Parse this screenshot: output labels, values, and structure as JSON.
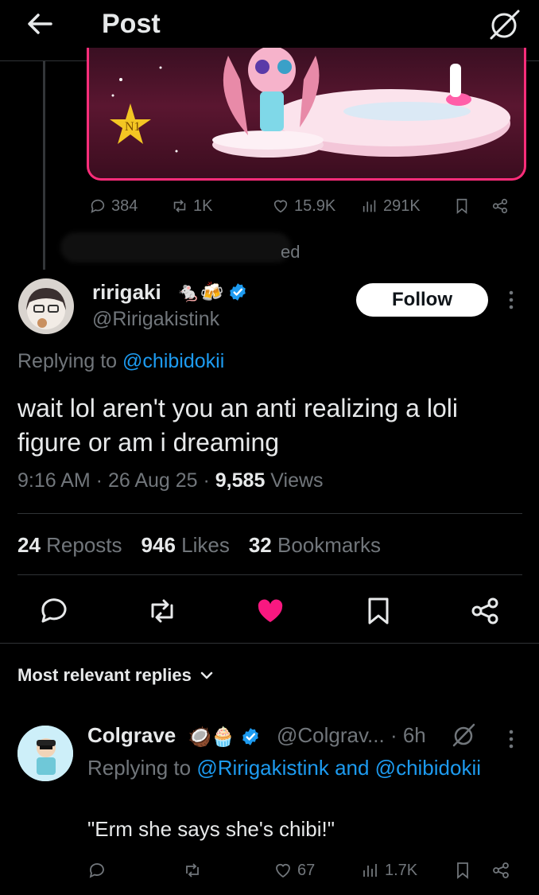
{
  "header": {
    "title": "Post"
  },
  "parent_post": {
    "stats": {
      "replies": "384",
      "reposts": "1K",
      "likes": "15.9K",
      "views": "291K"
    },
    "redacted_suffix": "ed"
  },
  "main_post": {
    "display_name": "ririgaki",
    "badges": "🐁🍻",
    "handle": "@Ririgakistink",
    "follow_label": "Follow",
    "replying_prefix": "Replying to ",
    "replying_to": "@chibidokii",
    "text": "wait lol aren't you an anti realizing a loli figure or am i dreaming",
    "time": "9:16 AM · 26 Aug 25 · ",
    "views_count": "9,585",
    "views_label": " Views",
    "reposts_count": "24",
    "reposts_label": " Reposts",
    "likes_count": "946",
    "likes_label": " Likes",
    "bookmarks_count": "32",
    "bookmarks_label": " Bookmarks",
    "colors": {
      "like": "#f91880",
      "verified": "#1d9bf0",
      "link": "#1d9bf0"
    }
  },
  "replies_sort": {
    "label": "Most relevant replies"
  },
  "reply": {
    "display_name": "Colgrave",
    "badges": "🥥🧁",
    "handle_time": "@Colgrav... · 6h",
    "replying_prefix": "Replying to ",
    "replying_to": "@Ririgakistink and @chibidokii",
    "text": "\"Erm she says she's chibi!\"",
    "stats": {
      "likes": "67",
      "views": "1.7K"
    }
  }
}
